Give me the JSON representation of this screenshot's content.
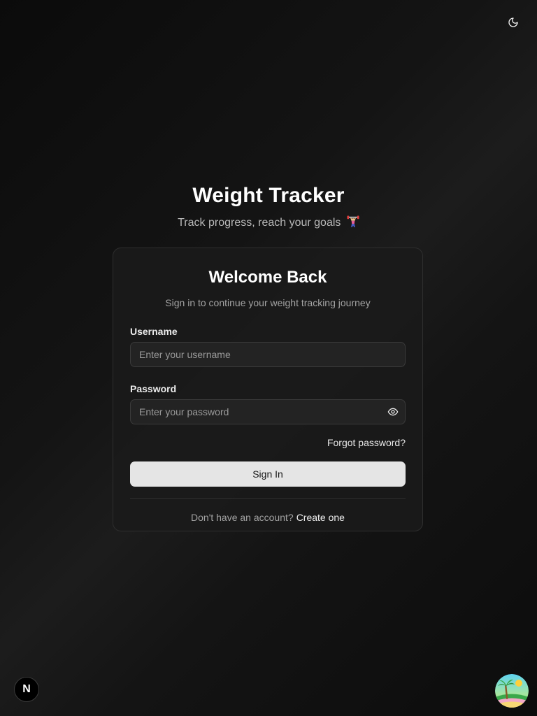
{
  "app": {
    "title": "Weight Tracker",
    "tagline": "Track progress, reach your goals"
  },
  "icons": {
    "theme_toggle": "moon-icon",
    "tagline_emoji": "weight-lifter-icon",
    "password_toggle": "eye-icon",
    "dev_badge": "nextjs-icon",
    "avatar": "tropical-beach-icon"
  },
  "login_card": {
    "title": "Welcome Back",
    "subtitle": "Sign in to continue your weight tracking journey",
    "username": {
      "label": "Username",
      "placeholder": "Enter your username",
      "value": ""
    },
    "password": {
      "label": "Password",
      "placeholder": "Enter your password",
      "value": ""
    },
    "forgot_password": "Forgot password?",
    "sign_in_button": "Sign In",
    "signup_prompt": "Don't have an account?",
    "create_account_link": "Create one"
  },
  "dev_badge": {
    "letter": "N"
  },
  "colors": {
    "background": "#121212",
    "card_background": "#1a1a1a",
    "card_border": "#2e2e2e",
    "primary_button": "#e5e5e5",
    "primary_button_text": "#171717",
    "muted_text": "#a3a3a3"
  }
}
